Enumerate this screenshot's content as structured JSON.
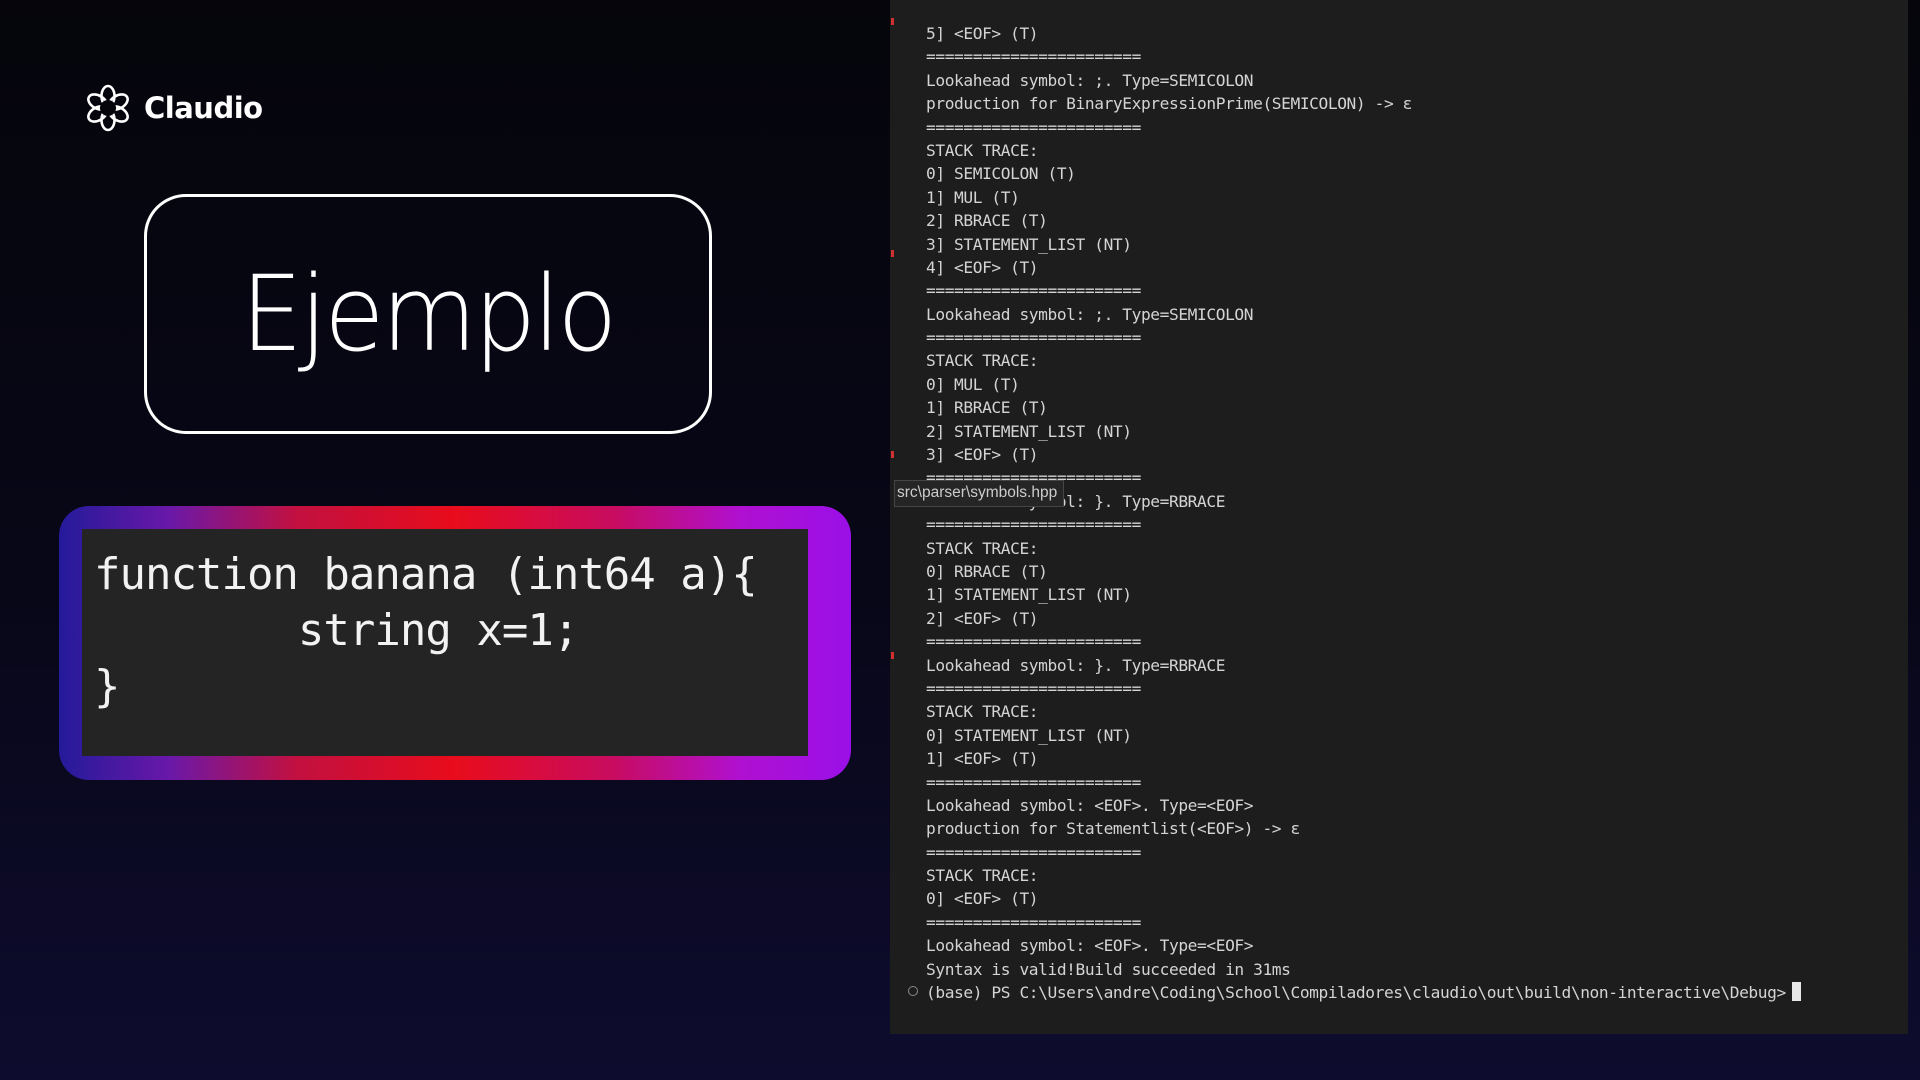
{
  "brand": {
    "name": "Claudio",
    "icon": "gear-flower-logo-icon"
  },
  "slide": {
    "title": "Ejemplo",
    "code_lines": [
      "function banana (int64 a){",
      "        string x=1;",
      "}"
    ]
  },
  "terminal": {
    "tooltip": "src\\parser\\symbols.hpp",
    "lines": [
      "5] <EOF> (T)",
      "=======================",
      "Lookahead symbol: ;. Type=SEMICOLON",
      "production for BinaryExpressionPrime(SEMICOLON) -> ε",
      "=======================",
      "STACK TRACE:",
      "0] SEMICOLON (T)",
      "1] MUL (T)",
      "2] RBRACE (T)",
      "3] STATEMENT_LIST (NT)",
      "4] <EOF> (T)",
      "=======================",
      "Lookahead symbol: ;. Type=SEMICOLON",
      "=======================",
      "STACK TRACE:",
      "0] MUL (T)",
      "1] RBRACE (T)",
      "2] STATEMENT_LIST (NT)",
      "3] <EOF> (T)",
      "=======================",
      "Lookahead symbol: }. Type=RBRACE",
      "=======================",
      "STACK TRACE:",
      "0] RBRACE (T)",
      "1] STATEMENT_LIST (NT)",
      "2] <EOF> (T)",
      "=======================",
      "Lookahead symbol: }. Type=RBRACE",
      "=======================",
      "STACK TRACE:",
      "0] STATEMENT_LIST (NT)",
      "1] <EOF> (T)",
      "=======================",
      "Lookahead symbol: <EOF>. Type=<EOF>",
      "production for Statementlist(<EOF>) -> ε",
      "=======================",
      "STACK TRACE:",
      "0] <EOF> (T)",
      "=======================",
      "Lookahead symbol: <EOF>. Type=<EOF>",
      "Syntax is valid!Build succeeded in 31ms",
      "(base) PS C:\\Users\\andre\\Coding\\School\\Compiladores\\claudio\\out\\build\\non-interactive\\Debug>"
    ]
  }
}
